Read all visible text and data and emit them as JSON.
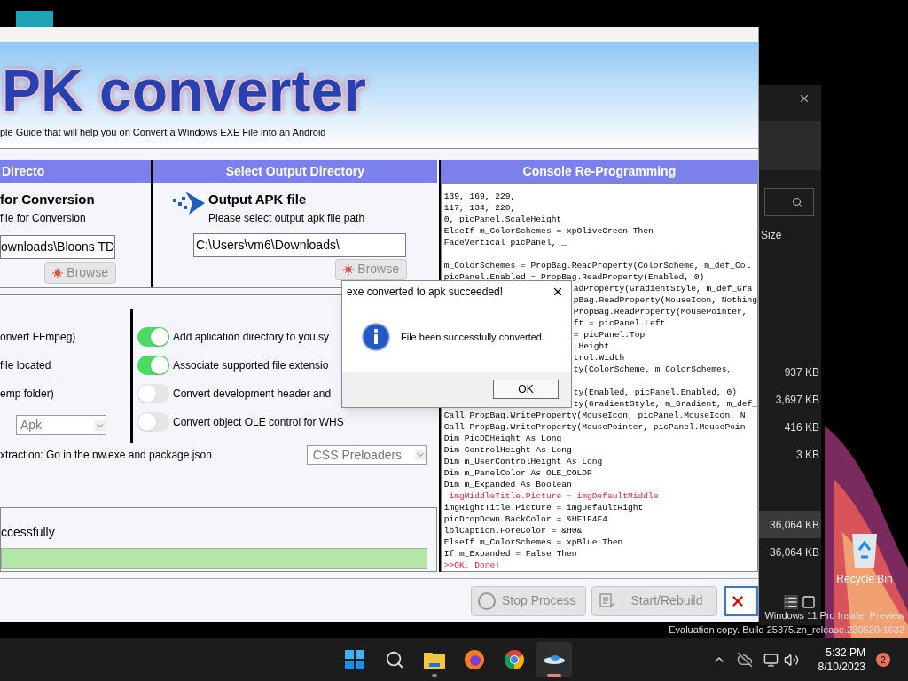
{
  "app": {
    "banner": {
      "logo": "PK converter",
      "subtitle": "ple Guide that will help you on  Convert a Windows EXE File into an Android"
    },
    "input_panel": {
      "header": "Directo",
      "title": "for Conversion",
      "hint": "file for Conversion",
      "path": "ownloads\\Bloons TD",
      "browse": {
        "label": "Browse",
        "disabled": true
      }
    },
    "output_panel": {
      "header": "Select Output Directory",
      "title": "Output APK file",
      "hint": "Please select output apk file path",
      "path": "C:\\Users\\vm6\\Downloads\\",
      "browse": {
        "label": "Browse",
        "disabled": true
      }
    },
    "options": [
      "onvert FFmpeg)",
      "file located",
      "emp folder)"
    ],
    "format_select": "Apk",
    "toggles": [
      {
        "label": "Add aplication directory to you sy",
        "on": true
      },
      {
        "label": "Associate supported file extensio",
        "on": true
      },
      {
        "label": "Convert development header and",
        "on": false
      },
      {
        "label": "Convert object OLE control for WHS",
        "on": false
      }
    ],
    "note": "xtraction: Go in the nw.exe and package.json",
    "preloader_select": "CSS Preloaders",
    "progress": {
      "message": "ccessfully",
      "level": 1
    },
    "console": {
      "header": "Console Re-Programming",
      "lines": [
        {
          "kind": "text",
          "text": "139, 169, 229,"
        },
        {
          "kind": "text",
          "text": "117, 134, 220,"
        },
        {
          "kind": "text",
          "text": "0, picPanel.ScaleHeight"
        },
        {
          "kind": "text",
          "text": "ElseIf m_ColorSchemes = xpOliveGreen Then"
        },
        {
          "kind": "text",
          "text": "FadeVertical picPanel, _"
        },
        {
          "kind": "blank"
        },
        {
          "kind": "text",
          "text": "m_ColorSchemes = PropBag.ReadProperty(ColorScheme, m_def_Col"
        },
        {
          "kind": "text",
          "text": "picPanel.Enabled = PropBag.ReadProperty(Enabled, 0)"
        },
        {
          "kind": "covered",
          "text": "adProperty(GradientStyle, m_def_Gra"
        },
        {
          "kind": "covered",
          "text": "pBag.ReadProperty(MouseIcon, Nothing"
        },
        {
          "kind": "covered",
          "text": "PropBag.ReadProperty(MousePointer,"
        },
        {
          "kind": "covered",
          "text": "ft = picPanel.Left"
        },
        {
          "kind": "covered",
          "text": "= picPanel.Top"
        },
        {
          "kind": "covered",
          "text": ".Height"
        },
        {
          "kind": "covered",
          "text": "trol.Width"
        },
        {
          "kind": "covered",
          "text": "ty(ColorScheme, m_ColorSchemes,"
        },
        {
          "kind": "blank"
        },
        {
          "kind": "covered",
          "text": "ty(Enabled, picPanel.Enabled, 0)"
        },
        {
          "kind": "covered",
          "text": "ty(GradientStyle, m_Gradient, m_def_"
        },
        {
          "kind": "text",
          "text": "Call PropBag.WriteProperty(MouseIcon, picPanel.MouseIcon, N"
        },
        {
          "kind": "text",
          "text": "Call PropBag.WriteProperty(MousePointer, picPanel.MousePoin"
        },
        {
          "kind": "text",
          "text": "Dim PicDDHeight As Long"
        },
        {
          "kind": "text",
          "text": "Dim ControlHeight As Long"
        },
        {
          "kind": "text",
          "text": "Dim m_UserControlHeight As Long"
        },
        {
          "kind": "text",
          "text": "Dim m_PanelColor As OLE_COLOR"
        },
        {
          "kind": "text",
          "text": "Dim m_Expanded As Boolean"
        },
        {
          "kind": "error",
          "text": " imgMiddleTitle.Picture = imgDefaultMiddle"
        },
        {
          "kind": "text",
          "text": "imgRightTitle.Picture = imgDefaultRight"
        },
        {
          "kind": "text",
          "text": "picDropDown.BackColor = &HF1F4F4"
        },
        {
          "kind": "text",
          "text": "lblCaption.ForeColor = &H0&"
        },
        {
          "kind": "text",
          "text": "ElseIf m_ColorSchemes = xpBlue Then"
        },
        {
          "kind": "text",
          "text": "If m_Expanded = False Then"
        },
        {
          "kind": "error",
          "text": ">>OK, Done!"
        }
      ]
    },
    "buttons": [
      {
        "kind": "stop",
        "label": "Stop Process",
        "disabled": true
      },
      {
        "kind": "start",
        "label": "Start/Rebuild",
        "disabled": true
      },
      {
        "kind": "close"
      }
    ]
  },
  "dialog": {
    "title": "exe converted to apk succeeded!",
    "message": "File been successfully converted.",
    "button": "OK"
  },
  "explorer": {
    "column": "Size",
    "groups": [
      {
        "rows": [
          {
            "size": "937 KB",
            "selected": false
          },
          {
            "size": "3,697 KB",
            "selected": false
          },
          {
            "size": "416 KB",
            "selected": false
          },
          {
            "size": "3 KB",
            "selected": false
          }
        ]
      },
      {
        "rows": [
          {
            "size": "36,064 KB",
            "selected": true
          },
          {
            "size": "36,064 KB",
            "selected": false
          }
        ]
      }
    ]
  },
  "desktop": {
    "icons": [
      {
        "label": "Recycle Bin"
      }
    ],
    "watermark": [
      "Windows 11 Pro Insider Preview",
      "Evaluation copy. Build 25375.zn_release.230520-1632"
    ]
  },
  "taskbar": {
    "apps": [
      {
        "kind": "start",
        "running": false,
        "active": false
      },
      {
        "kind": "search",
        "running": false,
        "active": false
      },
      {
        "kind": "folder",
        "running": true,
        "active": false
      },
      {
        "kind": "firefox",
        "running": false,
        "active": false
      },
      {
        "kind": "chrome",
        "running": false,
        "active": false
      },
      {
        "kind": "converter",
        "running": true,
        "active": true
      }
    ],
    "time": "5:32 PM",
    "date": "8/10/2023",
    "badge": "2"
  }
}
